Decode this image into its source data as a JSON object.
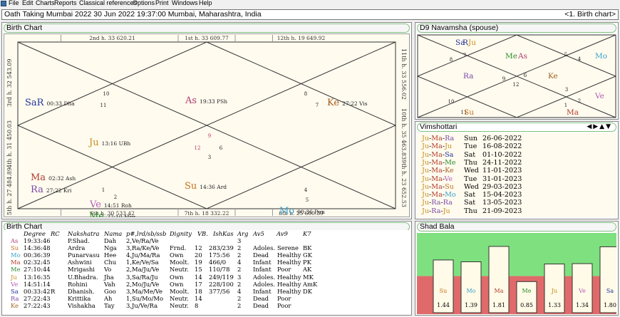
{
  "menu": [
    "File",
    "Edit",
    "Charts",
    "Reports",
    "Classical references",
    "Options",
    "Print",
    "Windows",
    "Help"
  ],
  "title": "Oath Taking Mumbai 2022  30 Jun 2022 19:37:00  Mumbai, Maharashtra, India",
  "title_right": "<1. Birth chart>",
  "birth_chart": {
    "title": "Birth Chart",
    "cusps_top": [
      "2nd h. 33 620.21",
      "1st h. 33 609.77",
      "12th h. 19 649.92"
    ],
    "cusps_bottom": [
      "6th h. 30 533.42",
      "7th h. 18 332.22",
      "8th h. 25 600.89"
    ],
    "cusps_left": [
      "3rd h. 32 543.09",
      "4th h. 31 450.03",
      "5th h. 27 484.89"
    ],
    "cusps_right": [
      "11th h. 33 556.02",
      "10th h. 35 463.83",
      "9th h. 23 652.53"
    ],
    "house_nums": [
      "1",
      "2",
      "3",
      "4",
      "5",
      "6",
      "7",
      "8",
      "9",
      "10",
      "11",
      "12"
    ],
    "planets": [
      {
        "abbr": "As",
        "deg": "19:33 PSh",
        "color": "#b03a6e"
      },
      {
        "abbr": "SaR",
        "deg": "00:33 Dha",
        "color": "#223399"
      },
      {
        "abbr": "Ke",
        "deg": "27:22 Vis",
        "color": "#a2601d"
      },
      {
        "abbr": "Ju",
        "deg": "13:16 UBh",
        "color": "#c98c1a"
      },
      {
        "abbr": "Ma",
        "deg": "02:32 Ash",
        "color": "#b03b2b"
      },
      {
        "abbr": "Ra",
        "deg": "27:22 Kri",
        "color": "#7a48a8"
      },
      {
        "abbr": "Su",
        "deg": "14:36 Ard",
        "color": "#c4701a"
      },
      {
        "abbr": "Ve",
        "deg": "14:51 Roh",
        "color": "#b25db3"
      },
      {
        "abbr": "Me",
        "deg": "27:10 Mrg",
        "color": "#2c8c2c"
      },
      {
        "abbr": "Mo",
        "deg": "00:36 Pun",
        "color": "#3aa0c9"
      }
    ]
  },
  "navamsha": {
    "title": "D9 Navamsha  (spouse)",
    "house_nums": [
      "1",
      "2",
      "3",
      "4",
      "5",
      "6",
      "7",
      "8",
      "9",
      "10",
      "11",
      "12"
    ],
    "planets": [
      "Sa",
      "R",
      "Ju",
      "Me",
      "As",
      "Mo",
      "Ra",
      "Ke",
      "Ve",
      "Su",
      "Ma"
    ]
  },
  "vimshottari": {
    "title": "Vimshottari",
    "rows": [
      {
        "p": [
          "Ju",
          "Ma",
          "Ra"
        ],
        "day": "Sun",
        "date": "26-06-2022"
      },
      {
        "p": [
          "Ju",
          "Ma",
          "Ju"
        ],
        "day": "Tue",
        "date": "16-08-2022"
      },
      {
        "p": [
          "Ju",
          "Ma",
          "Sa"
        ],
        "day": "Sat",
        "date": "01-10-2022"
      },
      {
        "p": [
          "Ju",
          "Ma",
          "Me"
        ],
        "day": "Thu",
        "date": "24-11-2022"
      },
      {
        "p": [
          "Ju",
          "Ma",
          "Ke"
        ],
        "day": "Wed",
        "date": "11-01-2023"
      },
      {
        "p": [
          "Ju",
          "Ma",
          "Ve"
        ],
        "day": "Tue",
        "date": "31-01-2023"
      },
      {
        "p": [
          "Ju",
          "Ma",
          "Su"
        ],
        "day": "Wed",
        "date": "29-03-2023"
      },
      {
        "p": [
          "Ju",
          "Ma",
          "Mo"
        ],
        "day": "Sat",
        "date": "15-04-2023"
      },
      {
        "p": [
          "Ju",
          "Ra",
          "Ra"
        ],
        "day": "Sat",
        "date": "13-05-2023"
      },
      {
        "p": [
          "Ju",
          "Ra",
          "Ju"
        ],
        "day": "Thu",
        "date": "21-09-2023"
      }
    ]
  },
  "planet_colors": {
    "Ju": "#c98c1a",
    "Ma": "#b03b2b",
    "Ra": "#7a48a8",
    "Sa": "#223399",
    "Me": "#2c8c2c",
    "Ke": "#a2601d",
    "Ve": "#b25db3",
    "Su": "#c4701a",
    "Mo": "#3aa0c9",
    "As": "#b03a6e"
  },
  "table": {
    "title": "Birth Chart",
    "headers": [
      "Degree",
      "RC",
      "Nakshatra",
      "Nama",
      "p#,lrd/sb/ssb",
      "Dignity",
      "VB.",
      "IshKas",
      "Arg",
      "Av5",
      "Av9",
      "K7"
    ],
    "rows": [
      [
        "As",
        "19:33:46",
        "",
        "P.Shad.",
        "Dah",
        "2,Ve/Ra/Ve",
        "",
        "",
        "",
        "3",
        "",
        "",
        ""
      ],
      [
        "Su",
        "14:36:48",
        "",
        "Ardra",
        "Nga",
        "3,Ra/Ke/Ve",
        "Frnd.",
        "12",
        "283/239",
        "2",
        "Adoles.",
        "Serene",
        "BK"
      ],
      [
        "Mo",
        "00:36:39",
        "",
        "Punarvasu",
        "Hee",
        "4,Ju/Ma/Ra",
        "Own",
        "20",
        "175:56",
        "2",
        "Dead",
        "Healthy",
        "GK"
      ],
      [
        "Ma",
        "02:32:45",
        "",
        "Ashwini",
        "Chu",
        "1,Ke/Ve/Sa",
        "Moolt.",
        "19",
        "466/0",
        "4",
        "Infant",
        "Healthy",
        "PK"
      ],
      [
        "Me",
        "27:10:44",
        "",
        "Mrigashi",
        "Vo",
        "2,Ma/Ju/Ve",
        "Neutr.",
        "15",
        "110/78",
        "2",
        "Infant",
        "Poor",
        "AK"
      ],
      [
        "Ju",
        "13:16:35",
        "",
        "U.Bhadra.",
        "Jha",
        "3,Sa/Ra/Ju",
        "Own",
        "14",
        "249/119",
        "3",
        "Adoles.",
        "Healthy",
        "MK"
      ],
      [
        "Ve",
        "14:51:14",
        "",
        "Rohini",
        "Vah",
        "2,Mo/Ju/Ve",
        "Own",
        "17",
        "228/100",
        "2",
        "Adoles.",
        "Healthy",
        "AmK"
      ],
      [
        "Sa",
        "00:33:42",
        "R",
        "Dhanish.",
        "Goo",
        "3,Ma/Me/Ve",
        "Moolt.",
        "18",
        "377/56",
        "4",
        "Infant",
        "Healthy",
        "DK"
      ],
      [
        "Ra",
        "27:22:43",
        "",
        "Krittika",
        "Ah",
        "1,Su/Mo/Mo",
        "Neutr.",
        "14",
        "",
        "2",
        "Dead",
        "Poor",
        ""
      ],
      [
        "Ke",
        "27:22:43",
        "",
        "Vishakha",
        "Tay",
        "3,Ju/Ve/Ra",
        "Neutr.",
        "8",
        "",
        "2",
        "Dead",
        "Poor",
        ""
      ]
    ]
  },
  "shad_bala": {
    "title": "Shad Bala",
    "chart_data": {
      "type": "bar",
      "categories": [
        "Su",
        "Mo",
        "Ma",
        "Me",
        "Ju",
        "Ve",
        "Sa"
      ],
      "values": [
        1.44,
        1.39,
        1.81,
        0.85,
        1.33,
        1.34,
        1.8
      ],
      "value_labels": [
        "1.44",
        "1.39",
        "1.81",
        "0.85",
        "1.33",
        "1.34",
        "1.80"
      ],
      "threshold": 1.0,
      "ylim": [
        0,
        2.1
      ],
      "colors": {
        "above": "#7fe07f",
        "below": "#e06a6a",
        "bar": "#fffbe8"
      }
    }
  }
}
